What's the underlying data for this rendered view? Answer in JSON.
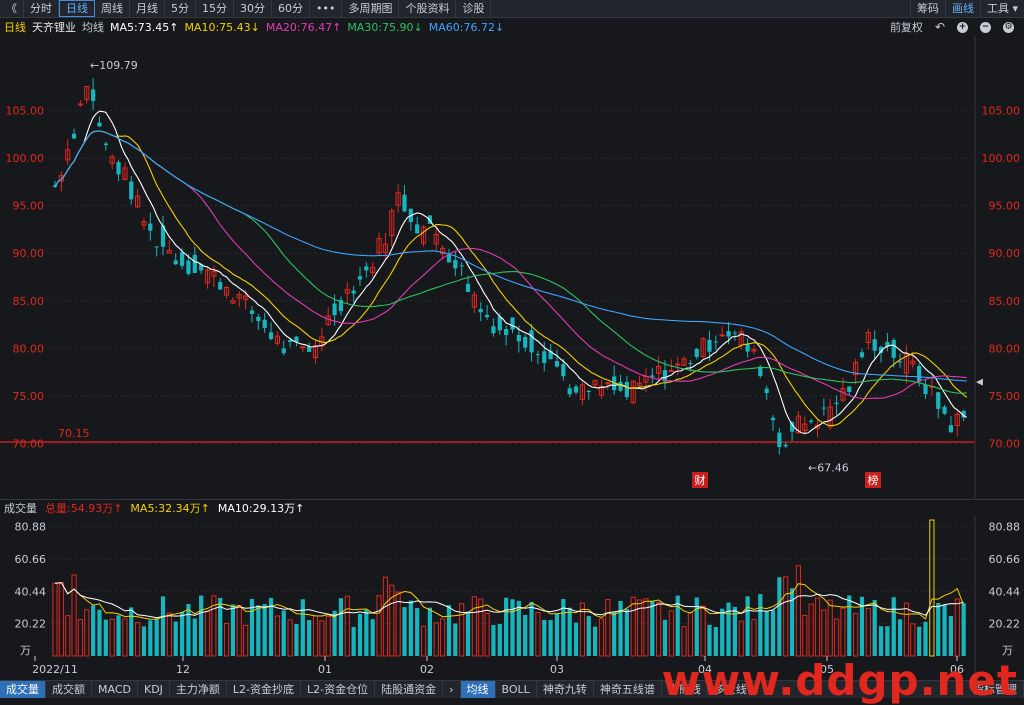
{
  "topbar": {
    "back": "《",
    "tabs": [
      "分时",
      "日线",
      "周线",
      "月线",
      "5分",
      "15分",
      "30分",
      "60分",
      "•••",
      "多周期图",
      "个股资料",
      "诊股"
    ],
    "active": 1,
    "right": [
      "筹码",
      "画线",
      "工具 ▾"
    ]
  },
  "info": {
    "period": "日线",
    "name": "天齐锂业",
    "ma_label": "均线",
    "ma5": "MA5:73.45↑",
    "ma10": "MA10:75.43↓",
    "ma20": "MA20:76.47↑",
    "ma30": "MA30:75.90↓",
    "ma60": "MA60:76.72↓",
    "adjust": "前复权",
    "colors": {
      "ma5": "#ffffff",
      "ma10": "#f5d000",
      "ma20": "#e23bb4",
      "ma30": "#2ec160",
      "ma60": "#3da4ff"
    }
  },
  "price_axis": {
    "ticks": [
      "105.00",
      "100.00",
      "95.00",
      "90.00",
      "85.00",
      "80.00",
      "75.00",
      "70.00"
    ],
    "values": [
      105,
      100,
      95,
      90,
      85,
      80,
      75,
      70
    ],
    "min": 65,
    "max": 112
  },
  "annotations": {
    "high": "109.79",
    "low": "67.46",
    "line_value": "70.15",
    "markers": [
      {
        "text": "财"
      },
      {
        "text": "榜"
      }
    ]
  },
  "volume": {
    "title": "成交量",
    "total": "总量:54.93万↑",
    "ma5": "MA5:32.34万↑",
    "ma10": "MA10:29.13万↑",
    "ticks": [
      "80.88",
      "60.66",
      "40.44",
      "20.22"
    ],
    "tick_values": [
      80.88,
      60.66,
      40.44,
      20.22
    ],
    "unit": "万",
    "max": 85
  },
  "xaxis": [
    "2022/11",
    "12",
    "01",
    "02",
    "03",
    "04",
    "05",
    "06"
  ],
  "bottombar": {
    "tabs": [
      "成交量",
      "成交额",
      "MACD",
      "KDJ",
      "主力净额",
      "L2-资金抄底",
      "L2-资金仓位",
      "陆股通资金",
      "›",
      "均线",
      "BOLL",
      "神奇九转",
      "神奇五线谱",
      "牛熊线",
      "多空线"
    ],
    "active": [
      0,
      9
    ],
    "right": "指标管理"
  },
  "watermark": "www.ddgp.net",
  "colors": {
    "up": "#e2281e",
    "down": "#17b6be",
    "bg": "#16181c",
    "grid": "#2a2d33",
    "line70": "#c81e1e"
  }
}
